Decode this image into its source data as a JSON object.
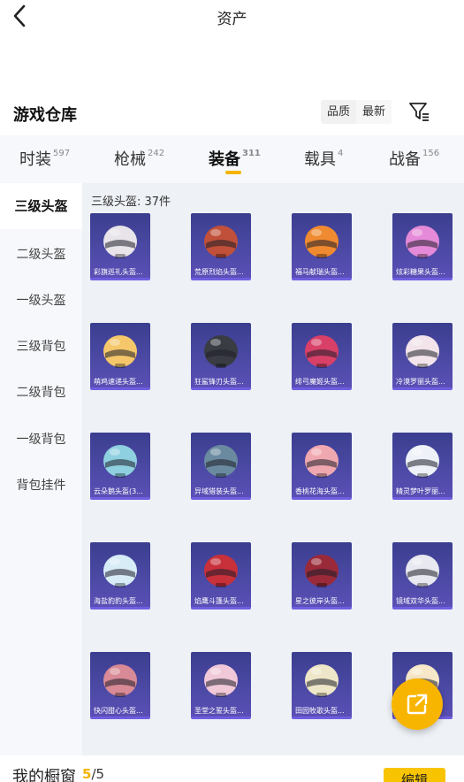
{
  "header": {
    "title": "资产"
  },
  "warehouse": {
    "title": "游戏仓库"
  },
  "sort": {
    "quality": "品质",
    "latest": "最新"
  },
  "tabs": [
    {
      "label": "时装",
      "count": "597"
    },
    {
      "label": "枪械",
      "count": "242"
    },
    {
      "label": "装备",
      "count": "311",
      "active": true
    },
    {
      "label": "载具",
      "count": "4"
    },
    {
      "label": "战备",
      "count": "156"
    }
  ],
  "sidebar": {
    "items": [
      {
        "label": "三级头盔",
        "active": true
      },
      {
        "label": "二级头盔"
      },
      {
        "label": "一级头盔"
      },
      {
        "label": "三级背包"
      },
      {
        "label": "二级背包"
      },
      {
        "label": "一级背包"
      },
      {
        "label": "背包挂件"
      }
    ]
  },
  "content": {
    "count_label": "三级头盔: 37件",
    "items": [
      {
        "name": "彩旗巡礼头盔...",
        "color": "#e8e4ea"
      },
      {
        "name": "荒原烈焰头盔...",
        "color": "#c0503a"
      },
      {
        "name": "福马献瑞头盔...",
        "color": "#f08a30"
      },
      {
        "name": "炫彩糖果头盔...",
        "color": "#e58ad8"
      },
      {
        "name": "萌鸡速递头盔...",
        "color": "#f5c76a"
      },
      {
        "name": "狂鲨锋刃头盔...",
        "color": "#3a3c44"
      },
      {
        "name": "绯弓魔姬头盔...",
        "color": "#d84068"
      },
      {
        "name": "冷漠罗丽头盔...",
        "color": "#f2e4ea"
      },
      {
        "name": "云朵鹅头盔(3...",
        "color": "#8fd0e0"
      },
      {
        "name": "异域猎装头盔...",
        "color": "#6a8aa0"
      },
      {
        "name": "香桃花海头盔...",
        "color": "#f0a8b0"
      },
      {
        "name": "精灵梦叶罗丽...",
        "color": "#eef2f8"
      },
      {
        "name": "海盐豹豹头盔...",
        "color": "#d8ecf8"
      },
      {
        "name": "焰鹰斗篷头盔...",
        "color": "#c8303a"
      },
      {
        "name": "星之彼岸头盔...",
        "color": "#9a2a3a"
      },
      {
        "name": "镜域双华头盔...",
        "color": "#e8e8f0"
      },
      {
        "name": "快闪甜心头盔...",
        "color": "#d88a96"
      },
      {
        "name": "圣堂之誓头盔...",
        "color": "#f0c8d8"
      },
      {
        "name": "田园牧歌头盔...",
        "color": "#eee6c8"
      },
      {
        "name": "",
        "color": "#f6e8c8"
      }
    ]
  },
  "bottom": {
    "label": "我的橱窗",
    "current": "5",
    "total": "/5",
    "edit_label": "编辑"
  },
  "colors": {
    "accent": "#f8b500",
    "card_bg": "#4a48a0"
  }
}
